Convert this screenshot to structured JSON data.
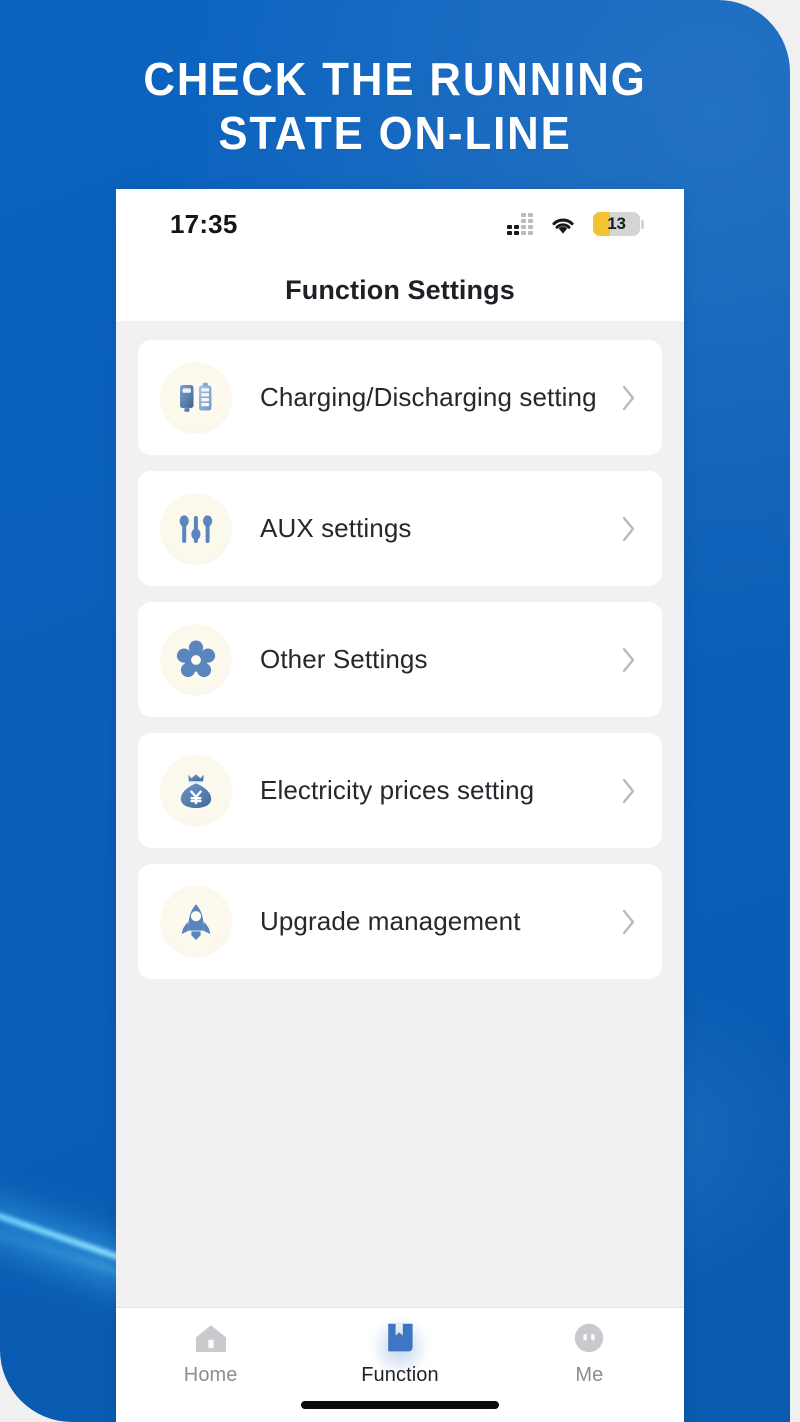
{
  "promo": {
    "headline": "Check the running state on-line",
    "background_color": "#0a5fb8",
    "accent_streak_color": "#7ad3ff"
  },
  "phone": {
    "status_bar": {
      "time": "17:35",
      "signal_icon": "cellular-signal-dots-icon",
      "wifi_icon": "wifi-icon",
      "battery": {
        "level_label": "13",
        "icon": "battery-low-power-icon",
        "fill_color": "#f4c430",
        "body_color": "#d3d4d6"
      }
    },
    "nav": {
      "title": "Function Settings"
    },
    "settings_list": [
      {
        "label": "Charging/Discharging setting",
        "icon": "charger-and-battery-icon",
        "chevron": "chevron-right-icon"
      },
      {
        "label": "AUX settings",
        "icon": "sliders-icon",
        "chevron": "chevron-right-icon"
      },
      {
        "label": "Other Settings",
        "icon": "gear-flower-icon",
        "chevron": "chevron-right-icon"
      },
      {
        "label": "Electricity prices setting",
        "icon": "money-bag-yen-icon",
        "chevron": "chevron-right-icon"
      },
      {
        "label": "Upgrade management",
        "icon": "rocket-icon",
        "chevron": "chevron-right-icon"
      }
    ],
    "tab_bar": {
      "items": [
        {
          "label": "Home",
          "icon": "home-icon",
          "active": false
        },
        {
          "label": "Function",
          "icon": "book-bookmark-icon",
          "active": true
        },
        {
          "label": "Me",
          "icon": "avatar-face-icon",
          "active": false
        }
      ],
      "active_color": "#3e76c4",
      "inactive_color": "#c9cacd"
    }
  }
}
